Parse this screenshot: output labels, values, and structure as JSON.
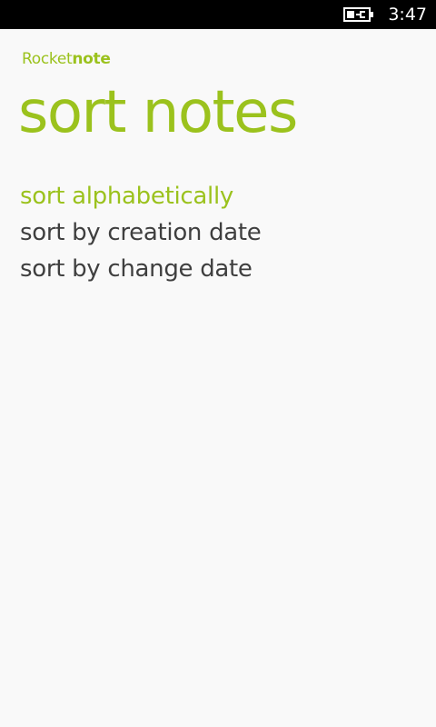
{
  "status_bar": {
    "time": "3:47",
    "battery_icon": "battery-charging-icon"
  },
  "app": {
    "name_regular": "Rocket",
    "name_bold": "note"
  },
  "page": {
    "title": "sort notes"
  },
  "sort_options": [
    {
      "label": "sort alphabetically",
      "selected": true
    },
    {
      "label": "sort by creation date",
      "selected": false
    },
    {
      "label": "sort by change date",
      "selected": false
    }
  ],
  "colors": {
    "accent": "#9bc21d",
    "text": "#3f3f3f",
    "background": "#f9f9f9",
    "status_bar": "#000000"
  }
}
